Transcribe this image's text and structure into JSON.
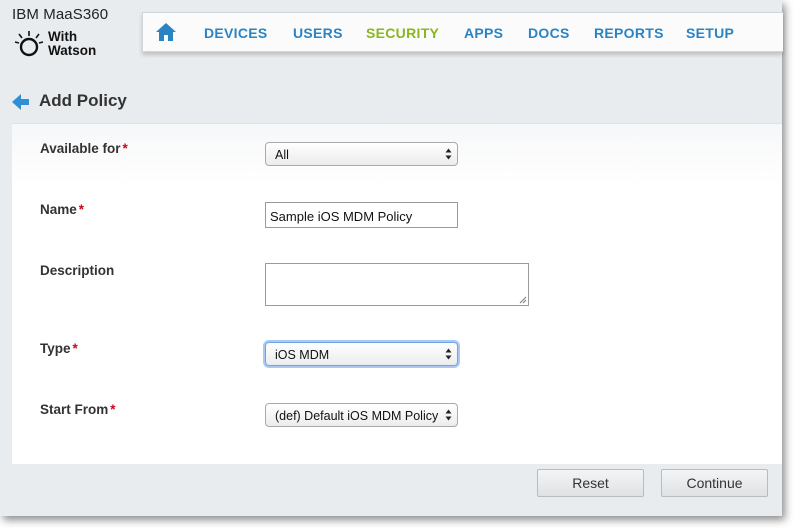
{
  "brand": {
    "name": "IBM MaaS360",
    "sub_line1": "With",
    "sub_line2": "Watson"
  },
  "nav": {
    "items": [
      {
        "label": "DEVICES"
      },
      {
        "label": "USERS"
      },
      {
        "label": "SECURITY",
        "active": true
      },
      {
        "label": "APPS"
      },
      {
        "label": "DOCS"
      },
      {
        "label": "REPORTS"
      },
      {
        "label": "SETUP"
      }
    ]
  },
  "page": {
    "title": "Add Policy"
  },
  "form": {
    "available_for": {
      "label": "Available for",
      "value": "All"
    },
    "name": {
      "label": "Name",
      "value": "Sample iOS MDM Policy"
    },
    "description": {
      "label": "Description",
      "value": ""
    },
    "type": {
      "label": "Type",
      "value": "iOS MDM"
    },
    "start_from": {
      "label": "Start From",
      "value": "(def) Default iOS MDM Policy"
    },
    "required_marker": "*"
  },
  "buttons": {
    "reset": "Reset",
    "continue": "Continue"
  },
  "colors": {
    "nav_link": "#2a84c4",
    "nav_active": "#8cb61f",
    "required": "#d0021b",
    "back_arrow": "#2f8fd6"
  }
}
